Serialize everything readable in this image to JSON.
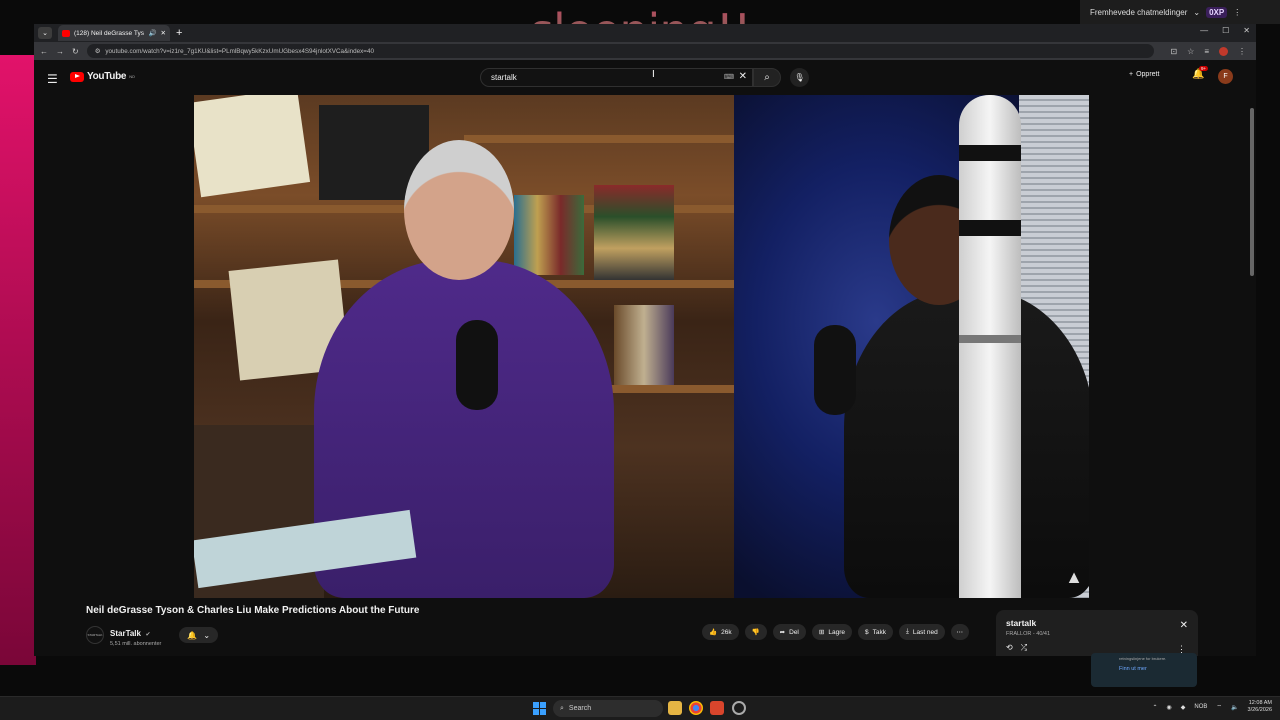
{
  "overlay": {
    "text": "sleeping!!"
  },
  "chat_dropdown": {
    "label": "Fremhevede chatmeldinger",
    "badge": "0XP"
  },
  "browser": {
    "tab_title": "(128) Neil deGrasse Tyson",
    "url": "youtube.com/watch?v=iz1re_7g1KU&list=PLmlBqwy5kKzxUmUGbesx4S94jnlotXVCa&index=40"
  },
  "youtube": {
    "logo": "YouTube",
    "logo_region": "NO",
    "search_value": "startalk",
    "create_label": "Opprett",
    "notif_badge": "9+",
    "avatar_letter": "F",
    "video_title": "Neil deGrasse Tyson & Charles Liu Make Predictions About the Future",
    "channel_name": "StarTalk",
    "channel_subs": "5,51 mill. abonnenter",
    "channel_avatar_text": "STARTALK",
    "actions": {
      "likes": "26k",
      "share": "Del",
      "save": "Lagre",
      "thanks": "Takk",
      "download": "Last ned"
    },
    "playlist": {
      "title": "startalk",
      "subtitle": "FRALLOR - 40/41"
    },
    "notice": {
      "text": "retningslinjene for brukere.",
      "link": "Finn ut mer"
    }
  },
  "taskbar": {
    "search_label": "Search",
    "lang": "NOB",
    "time": "12:08 AM",
    "date": "3/26/2026"
  }
}
